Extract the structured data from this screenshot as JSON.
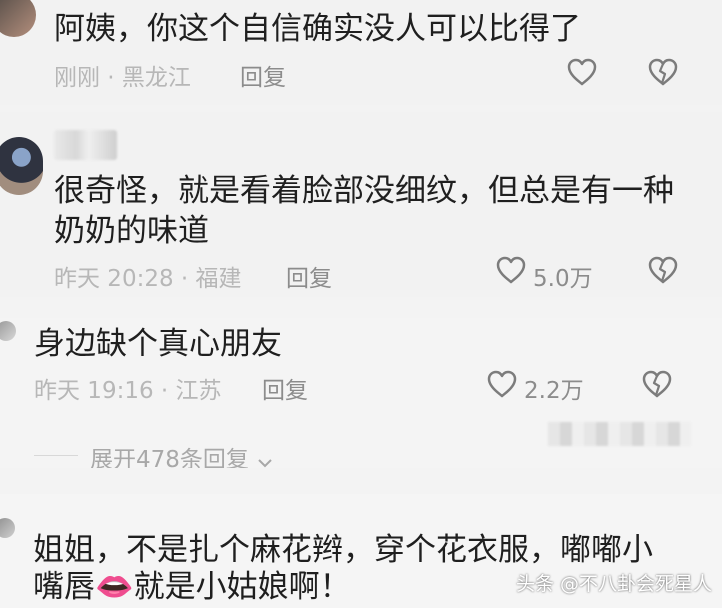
{
  "comments": [
    {
      "text_lines": [
        "阿姨，你这个自信确实没人可以比得了"
      ],
      "meta": "刚刚 · 黑龙江",
      "reply_label": "回复",
      "likes": ""
    },
    {
      "text_lines": [
        "很奇怪，就是看着脸部没细纹，但总是有一种",
        "奶奶的味道"
      ],
      "meta": "昨天 20:28 · 福建",
      "reply_label": "回复",
      "likes": "5.0万"
    },
    {
      "text_lines": [
        "身边缺个真心朋友"
      ],
      "meta": "昨天 19:16 · 江苏",
      "reply_label": "回复",
      "likes": "2.2万"
    },
    {
      "text_lines": [
        "姐姐，不是扎个麻花辫，穿个花衣服，嘟嘟小",
        "嘴唇👄就是小姑娘啊！"
      ],
      "meta": "",
      "reply_label": "",
      "likes": ""
    }
  ],
  "expand_replies": "展开478条回复",
  "watermark": "头条 @不八卦会死星人",
  "icons": {
    "like": "heart-outline-icon",
    "dislike": "broken-heart-icon",
    "expand": "chevron-down-icon"
  },
  "colors": {
    "background": "#f3f3f3",
    "text": "#1f1f1f",
    "meta": "#b7b7b7",
    "action": "#8c8c8c"
  }
}
